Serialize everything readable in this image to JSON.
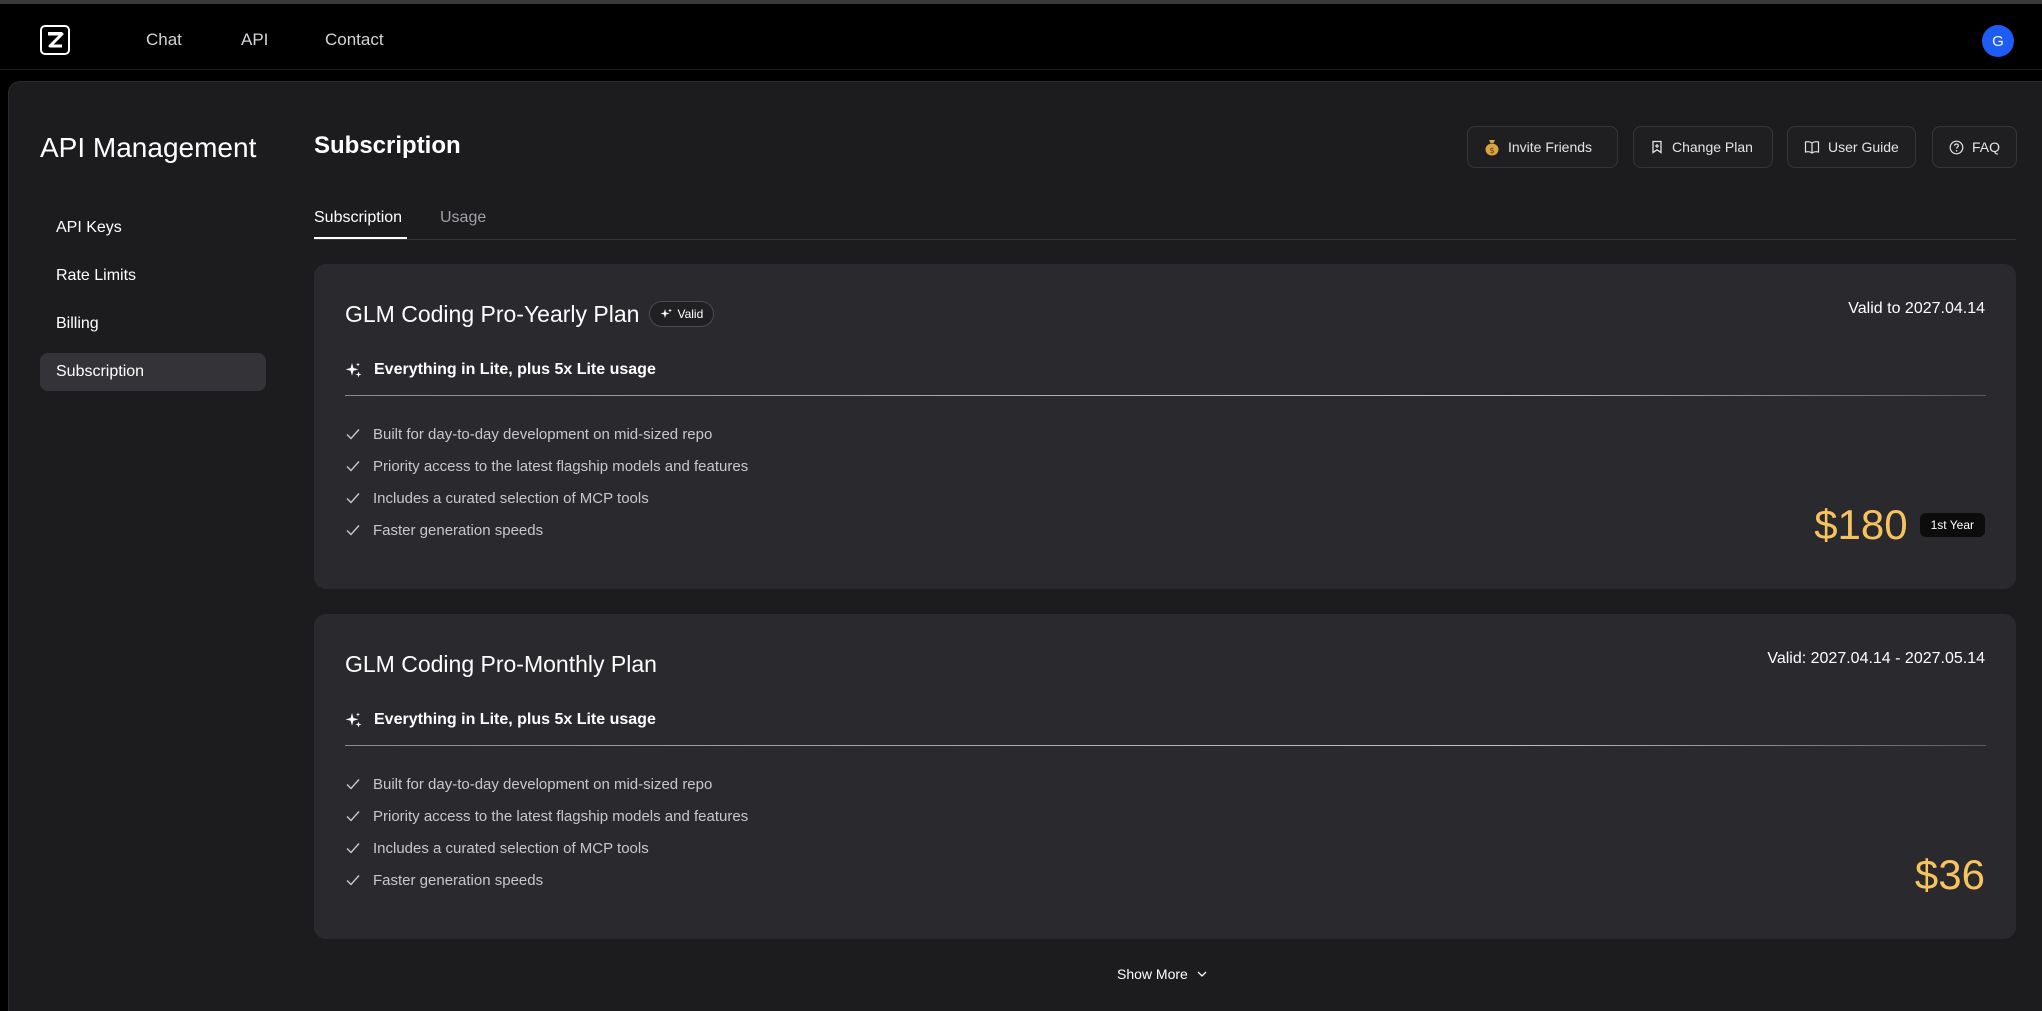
{
  "nav": {
    "logo_letter": "Z",
    "items": [
      {
        "label": "Chat"
      },
      {
        "label": "API"
      },
      {
        "label": "Contact"
      }
    ],
    "avatar_initial": "G"
  },
  "sidebar": {
    "title": "API Management",
    "items": [
      {
        "label": "API Keys",
        "active": false
      },
      {
        "label": "Rate Limits",
        "active": false
      },
      {
        "label": "Billing",
        "active": false
      },
      {
        "label": "Subscription",
        "active": true
      }
    ]
  },
  "main": {
    "title": "Subscription",
    "toolbar": {
      "invite_label": "Invite Friends",
      "change_plan_label": "Change Plan",
      "user_guide_label": "User Guide",
      "faq_label": "FAQ"
    },
    "tabs": [
      {
        "label": "Subscription",
        "active": true
      },
      {
        "label": "Usage",
        "active": false
      }
    ],
    "plans": [
      {
        "name": "GLM Coding Pro-Yearly Plan",
        "badge": "Valid",
        "validity": "Valid to 2027.04.14",
        "highlight": "Everything in Lite, plus 5x Lite usage",
        "features": [
          "Built for day-to-day development on mid-sized repo",
          "Priority access to the latest flagship models and features",
          "Includes a curated selection of MCP tools",
          "Faster generation speeds"
        ],
        "price": "$180",
        "period": "1st Year"
      },
      {
        "name": "GLM Coding Pro-Monthly Plan",
        "validity": "Valid: 2027.04.14 - 2027.05.14",
        "highlight": "Everything in Lite, plus 5x Lite usage",
        "features": [
          "Built for day-to-day development on mid-sized repo",
          "Priority access to the latest flagship models and features",
          "Includes a curated selection of MCP tools",
          "Faster generation speeds"
        ],
        "price": "$36"
      }
    ],
    "show_more_label": "Show More"
  },
  "colors": {
    "accent_price": "#f7c35f",
    "avatar_bg": "#1d5cf5",
    "card_bg": "#2a2a2e",
    "panel_bg": "#1c1c1e"
  },
  "icons": {
    "invite": "money-bag-icon",
    "change_plan": "bookmark-icon",
    "user_guide": "book-icon",
    "faq": "help-circle-icon",
    "highlight": "sparkles-icon",
    "feature": "check-icon",
    "show_more": "chevron-down-icon"
  }
}
